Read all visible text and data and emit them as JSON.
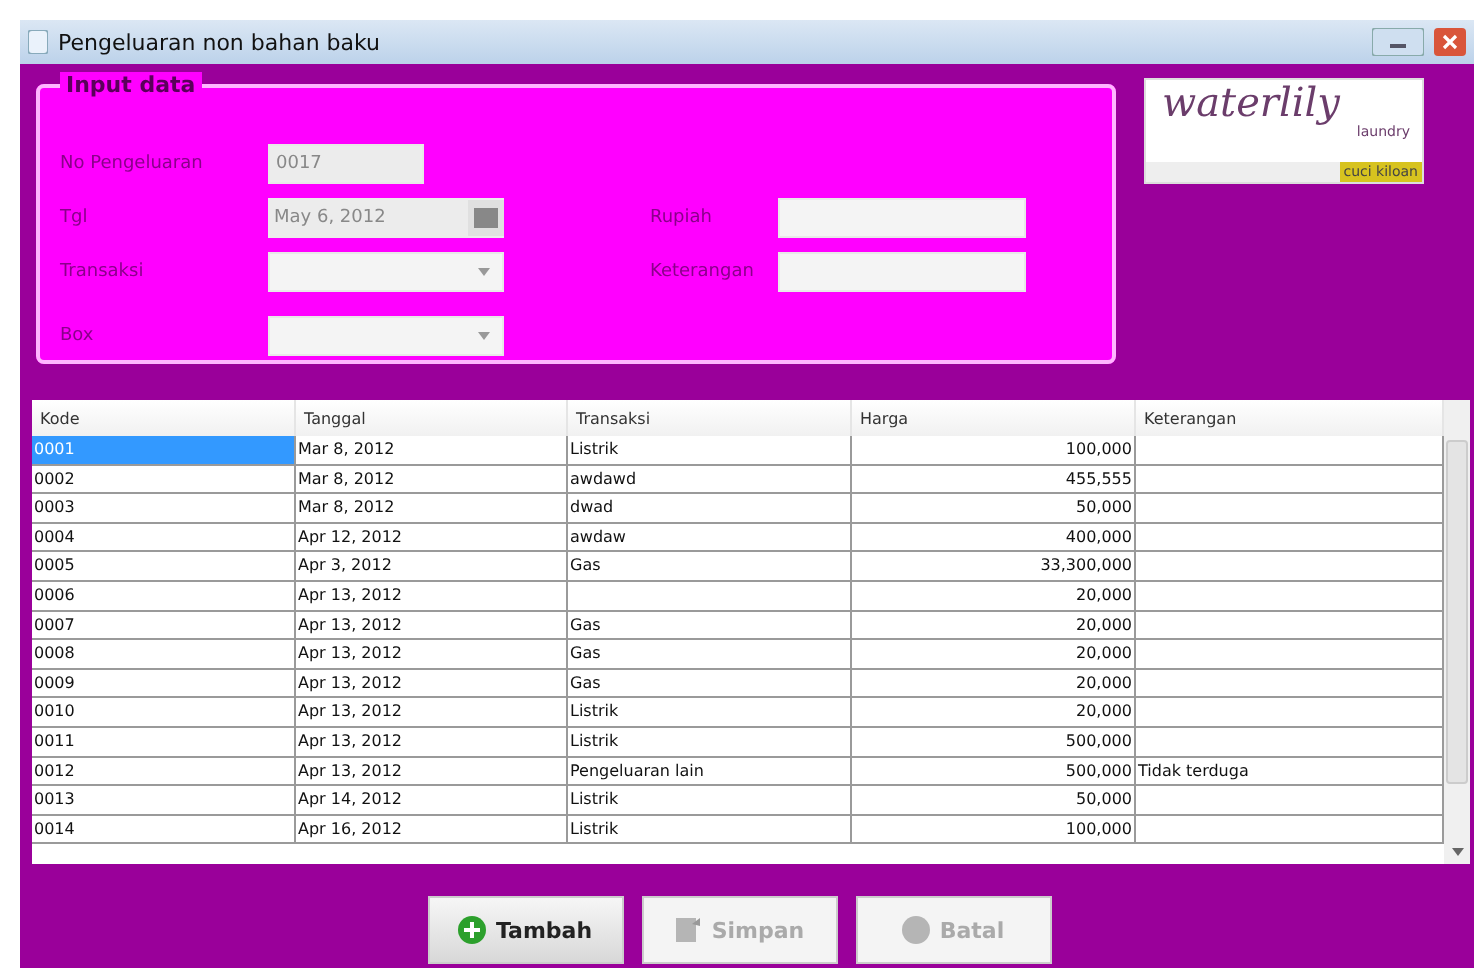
{
  "window": {
    "title": "Pengeluaran non bahan baku"
  },
  "input_panel": {
    "title": "Input data",
    "left_fields": [
      {
        "label": "No Pengeluaran",
        "value": "0017",
        "kind": "text"
      },
      {
        "label": "Tgl",
        "value": "May 6, 2012",
        "kind": "date"
      },
      {
        "label": "Transaksi",
        "kind": "dropdown"
      },
      {
        "label": "Box",
        "kind": "dropdown"
      }
    ],
    "right_fields": [
      {
        "label": "Rupiah",
        "kind": "text"
      },
      {
        "label": "Keterangan",
        "kind": "text"
      }
    ]
  },
  "logo": {
    "name": "waterlily",
    "sub": "laundry",
    "tag": "cuci kiloan"
  },
  "table": {
    "columns": [
      "Kode",
      "Tanggal",
      "Transaksi",
      "Harga",
      "Keterangan"
    ],
    "rows": [
      {
        "cells": [
          "0001",
          "Mar 8, 2012",
          "Listrik",
          "100,000",
          ""
        ],
        "selected": true
      },
      {
        "cells": [
          "0002",
          "Mar 8, 2012",
          "awdawd",
          "455,555",
          ""
        ],
        "selected": false
      },
      {
        "cells": [
          "0003",
          "Mar 8, 2012",
          "dwad",
          "50,000",
          ""
        ],
        "selected": false
      },
      {
        "cells": [
          "0004",
          "Apr 12, 2012",
          "awdaw",
          "400,000",
          ""
        ],
        "selected": false
      },
      {
        "cells": [
          "0005",
          "Apr 3, 2012",
          "Gas",
          "33,300,000",
          ""
        ],
        "selected": false
      },
      {
        "cells": [
          "0006",
          "Apr 13, 2012",
          "",
          "20,000",
          ""
        ],
        "selected": false
      },
      {
        "cells": [
          "0007",
          "Apr 13, 2012",
          "Gas",
          "20,000",
          ""
        ],
        "selected": false
      },
      {
        "cells": [
          "0008",
          "Apr 13, 2012",
          "Gas",
          "20,000",
          ""
        ],
        "selected": false
      },
      {
        "cells": [
          "0009",
          "Apr 13, 2012",
          "Gas",
          "20,000",
          ""
        ],
        "selected": false
      },
      {
        "cells": [
          "0010",
          "Apr 13, 2012",
          "Listrik",
          "20,000",
          ""
        ],
        "selected": false
      },
      {
        "cells": [
          "0011",
          "Apr 13, 2012",
          "Listrik",
          "500,000",
          ""
        ],
        "selected": false
      },
      {
        "cells": [
          "0012",
          "Apr 13, 2012",
          "Pengeluaran lain",
          "500,000",
          "Tidak terduga"
        ],
        "selected": false
      },
      {
        "cells": [
          "0013",
          "Apr 14, 2012",
          "Listrik",
          "50,000",
          ""
        ],
        "selected": false
      },
      {
        "cells": [
          "0014",
          "Apr 16, 2012",
          "Listrik",
          "100,000",
          ""
        ],
        "selected": false
      }
    ]
  },
  "buttons": [
    {
      "label": "Tambah",
      "kind": "add",
      "disabled": false
    },
    {
      "label": "Simpan",
      "kind": "save",
      "disabled": true
    },
    {
      "label": "Batal",
      "kind": "cancel",
      "disabled": true
    }
  ]
}
